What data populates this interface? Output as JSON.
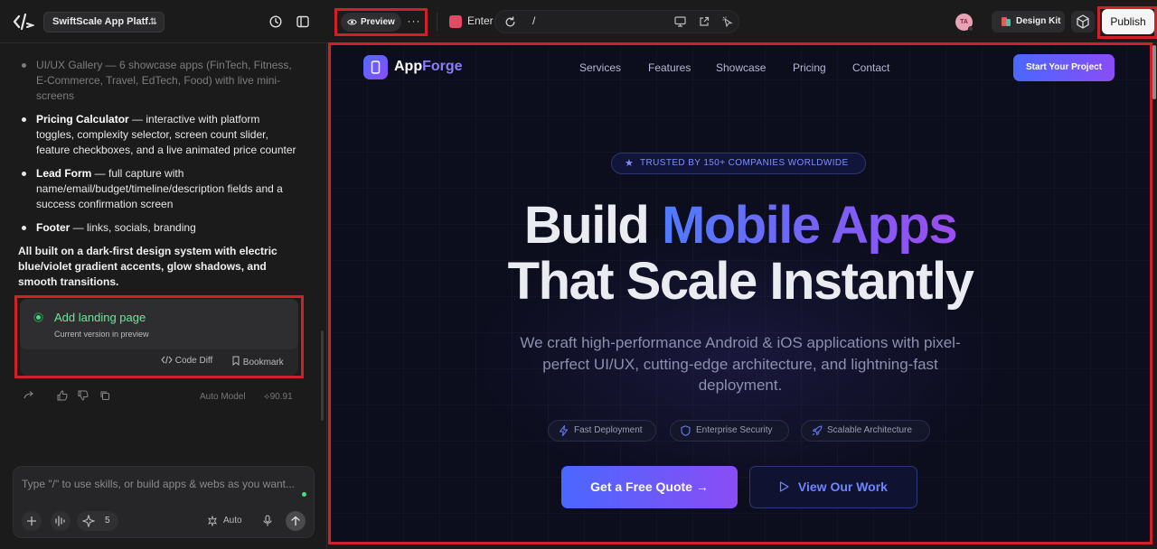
{
  "topbar": {
    "project_name": "SwiftScale App Platf...",
    "preview_label": "Preview",
    "more_label": "···",
    "enter_label": "Enter",
    "url_path": "/",
    "avatar_initials": "TA",
    "design_kit_label": "Design Kit",
    "publish_label": "Publish"
  },
  "chat": {
    "items": [
      {
        "title": "",
        "text": "UI/UX Gallery — 6 showcase apps (FinTech, Fitness, E-Commerce, Travel, EdTech, Food) with live mini-screens",
        "faded": true
      },
      {
        "title": "Pricing Calculator",
        "text": " — interactive with platform toggles, complexity selector, screen count slider, feature checkboxes, and a live animated price counter"
      },
      {
        "title": "Lead Form",
        "text": " — full capture with name/email/budget/timeline/description fields and a success confirmation screen"
      },
      {
        "title": "Footer",
        "text": " — links, socials, branding"
      }
    ],
    "summary": "All built on a dark-first design system with electric blue/violet gradient accents, glow shadows, and smooth transitions.",
    "version": {
      "title": "Add landing page",
      "subtitle": "Current version in preview",
      "code_diff_label": "Code Diff",
      "bookmark_label": "Bookmark"
    },
    "model_label": "Auto Model",
    "credits": "90.91",
    "composer": {
      "placeholder": "Type \"/\" to use skills, or build apps & webs as you want...",
      "skills_count": "5",
      "auto_label": "Auto"
    }
  },
  "site": {
    "brand_part1": "App",
    "brand_part2": "Forge",
    "nav": [
      "Services",
      "Features",
      "Showcase",
      "Pricing",
      "Contact"
    ],
    "cta": "Start Your Project",
    "badge": "TRUSTED BY 150+ COMPANIES WORLDWIDE",
    "headline_1a": "Build ",
    "headline_1b": "Mobile Apps",
    "headline_2": "That Scale Instantly",
    "description": "We craft high-performance Android & iOS applications with pixel-perfect UI/UX, cutting-edge architecture, and lightning-fast deployment.",
    "features": [
      "Fast Deployment",
      "Enterprise Security",
      "Scalable Architecture"
    ],
    "primary_button": "Get a Free Quote →",
    "secondary_button": "View Our Work"
  },
  "colors": {
    "accent_blue": "#4f7bff",
    "accent_violet": "#9a4df0",
    "annotation_red": "#d0202a",
    "success_green": "#4ade80"
  }
}
